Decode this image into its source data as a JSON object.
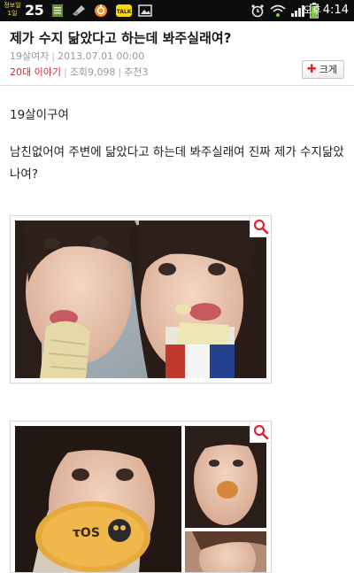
{
  "status_bar": {
    "date_line1": "정보일",
    "date_line2": "1일",
    "day": "25",
    "ampm": "오후",
    "time": "4:14",
    "icons": [
      "memo-icon",
      "usb-icon",
      "notification-icon",
      "kakaotalk-icon",
      "gallery-icon",
      "alarm-icon",
      "wifi-icon",
      "signal-icon",
      "battery-icon"
    ],
    "kakao_label": "TALK"
  },
  "article": {
    "title": "제가 수지 닮았다고 하는데 봐주실래여?",
    "author": "19살여자",
    "date": "2013.07.01 00:00",
    "category": "20대 이야기",
    "views": "조회9,098",
    "recommend": "추천3",
    "enlarge_label": "크게",
    "paragraph1": "19살이구여",
    "paragraph2": "남친없어여 주변에  닮았다고 하는데 봐주실래여 진짜 제가 수지닮았나여?"
  },
  "colors": {
    "accent": "#d8262f",
    "meta": "#9a9a9a",
    "statusbar": "#0d0d0d"
  }
}
